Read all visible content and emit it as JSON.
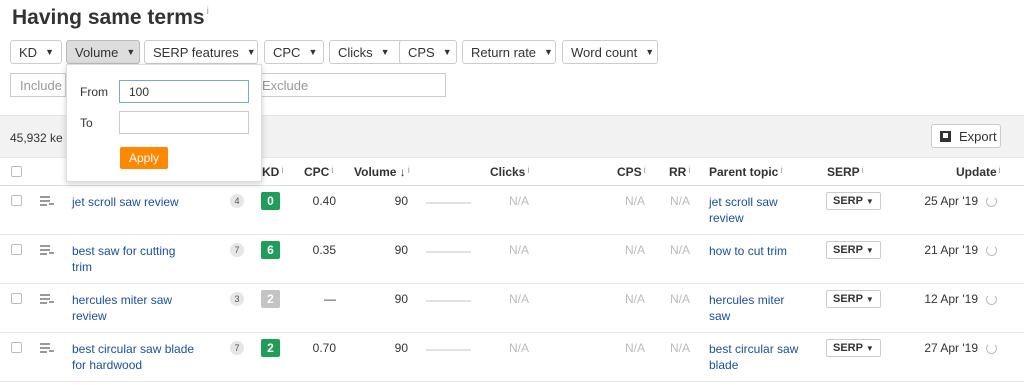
{
  "page": {
    "title": "Having same terms",
    "info_glyph": "i"
  },
  "filters": [
    {
      "label": "KD",
      "active": false
    },
    {
      "label": "Volume",
      "active": true
    },
    {
      "label": "SERP features",
      "active": false
    },
    {
      "label": "CPC",
      "active": false
    },
    {
      "label": "Clicks",
      "active": false
    },
    {
      "label": "CPS",
      "active": false
    },
    {
      "label": "Return rate",
      "active": false
    },
    {
      "label": "Word count",
      "active": false
    }
  ],
  "include_placeholder": "Include",
  "exclude_placeholder": "Exclude",
  "results_count": "45,932 ke",
  "export_label": "Export",
  "volume_popup": {
    "from_label": "From",
    "from_value": "100",
    "to_label": "To",
    "to_value": "",
    "apply_label": "Apply"
  },
  "columns": {
    "kd": "KD",
    "cpc": "CPC",
    "volume": "Volume ↓",
    "clicks": "Clicks",
    "cps": "CPS",
    "rr": "RR",
    "parent_topic": "Parent topic",
    "serp": "SERP",
    "update": "Update"
  },
  "rows": [
    {
      "keyword": "jet scroll saw review",
      "count": "4",
      "kd": "0",
      "kd_color": "#1e9e5a",
      "cpc": "0.40",
      "volume": "90",
      "clicks": "N/A",
      "cps": "N/A",
      "rr": "N/A",
      "parent_topic": "jet scroll saw review",
      "serp": "SERP",
      "update": "25 Apr '19"
    },
    {
      "keyword": "best saw for cutting trim",
      "count": "7",
      "kd": "6",
      "kd_color": "#1e9e5a",
      "cpc": "0.35",
      "volume": "90",
      "clicks": "N/A",
      "cps": "N/A",
      "rr": "N/A",
      "parent_topic": "how to cut trim",
      "serp": "SERP",
      "update": "21 Apr '19"
    },
    {
      "keyword": "hercules miter saw review",
      "count": "3",
      "kd": "2",
      "kd_color": "#c4c4c4",
      "cpc": "—",
      "volume": "90",
      "clicks": "N/A",
      "cps": "N/A",
      "rr": "N/A",
      "parent_topic": "hercules miter saw",
      "serp": "SERP",
      "update": "12 Apr '19"
    },
    {
      "keyword": "best circular saw blade for hardwood",
      "count": "7",
      "kd": "2",
      "kd_color": "#1e9e5a",
      "cpc": "0.70",
      "volume": "90",
      "clicks": "N/A",
      "cps": "N/A",
      "rr": "N/A",
      "parent_topic": "best circular saw blade",
      "serp": "SERP",
      "update": "27 Apr '19"
    }
  ]
}
